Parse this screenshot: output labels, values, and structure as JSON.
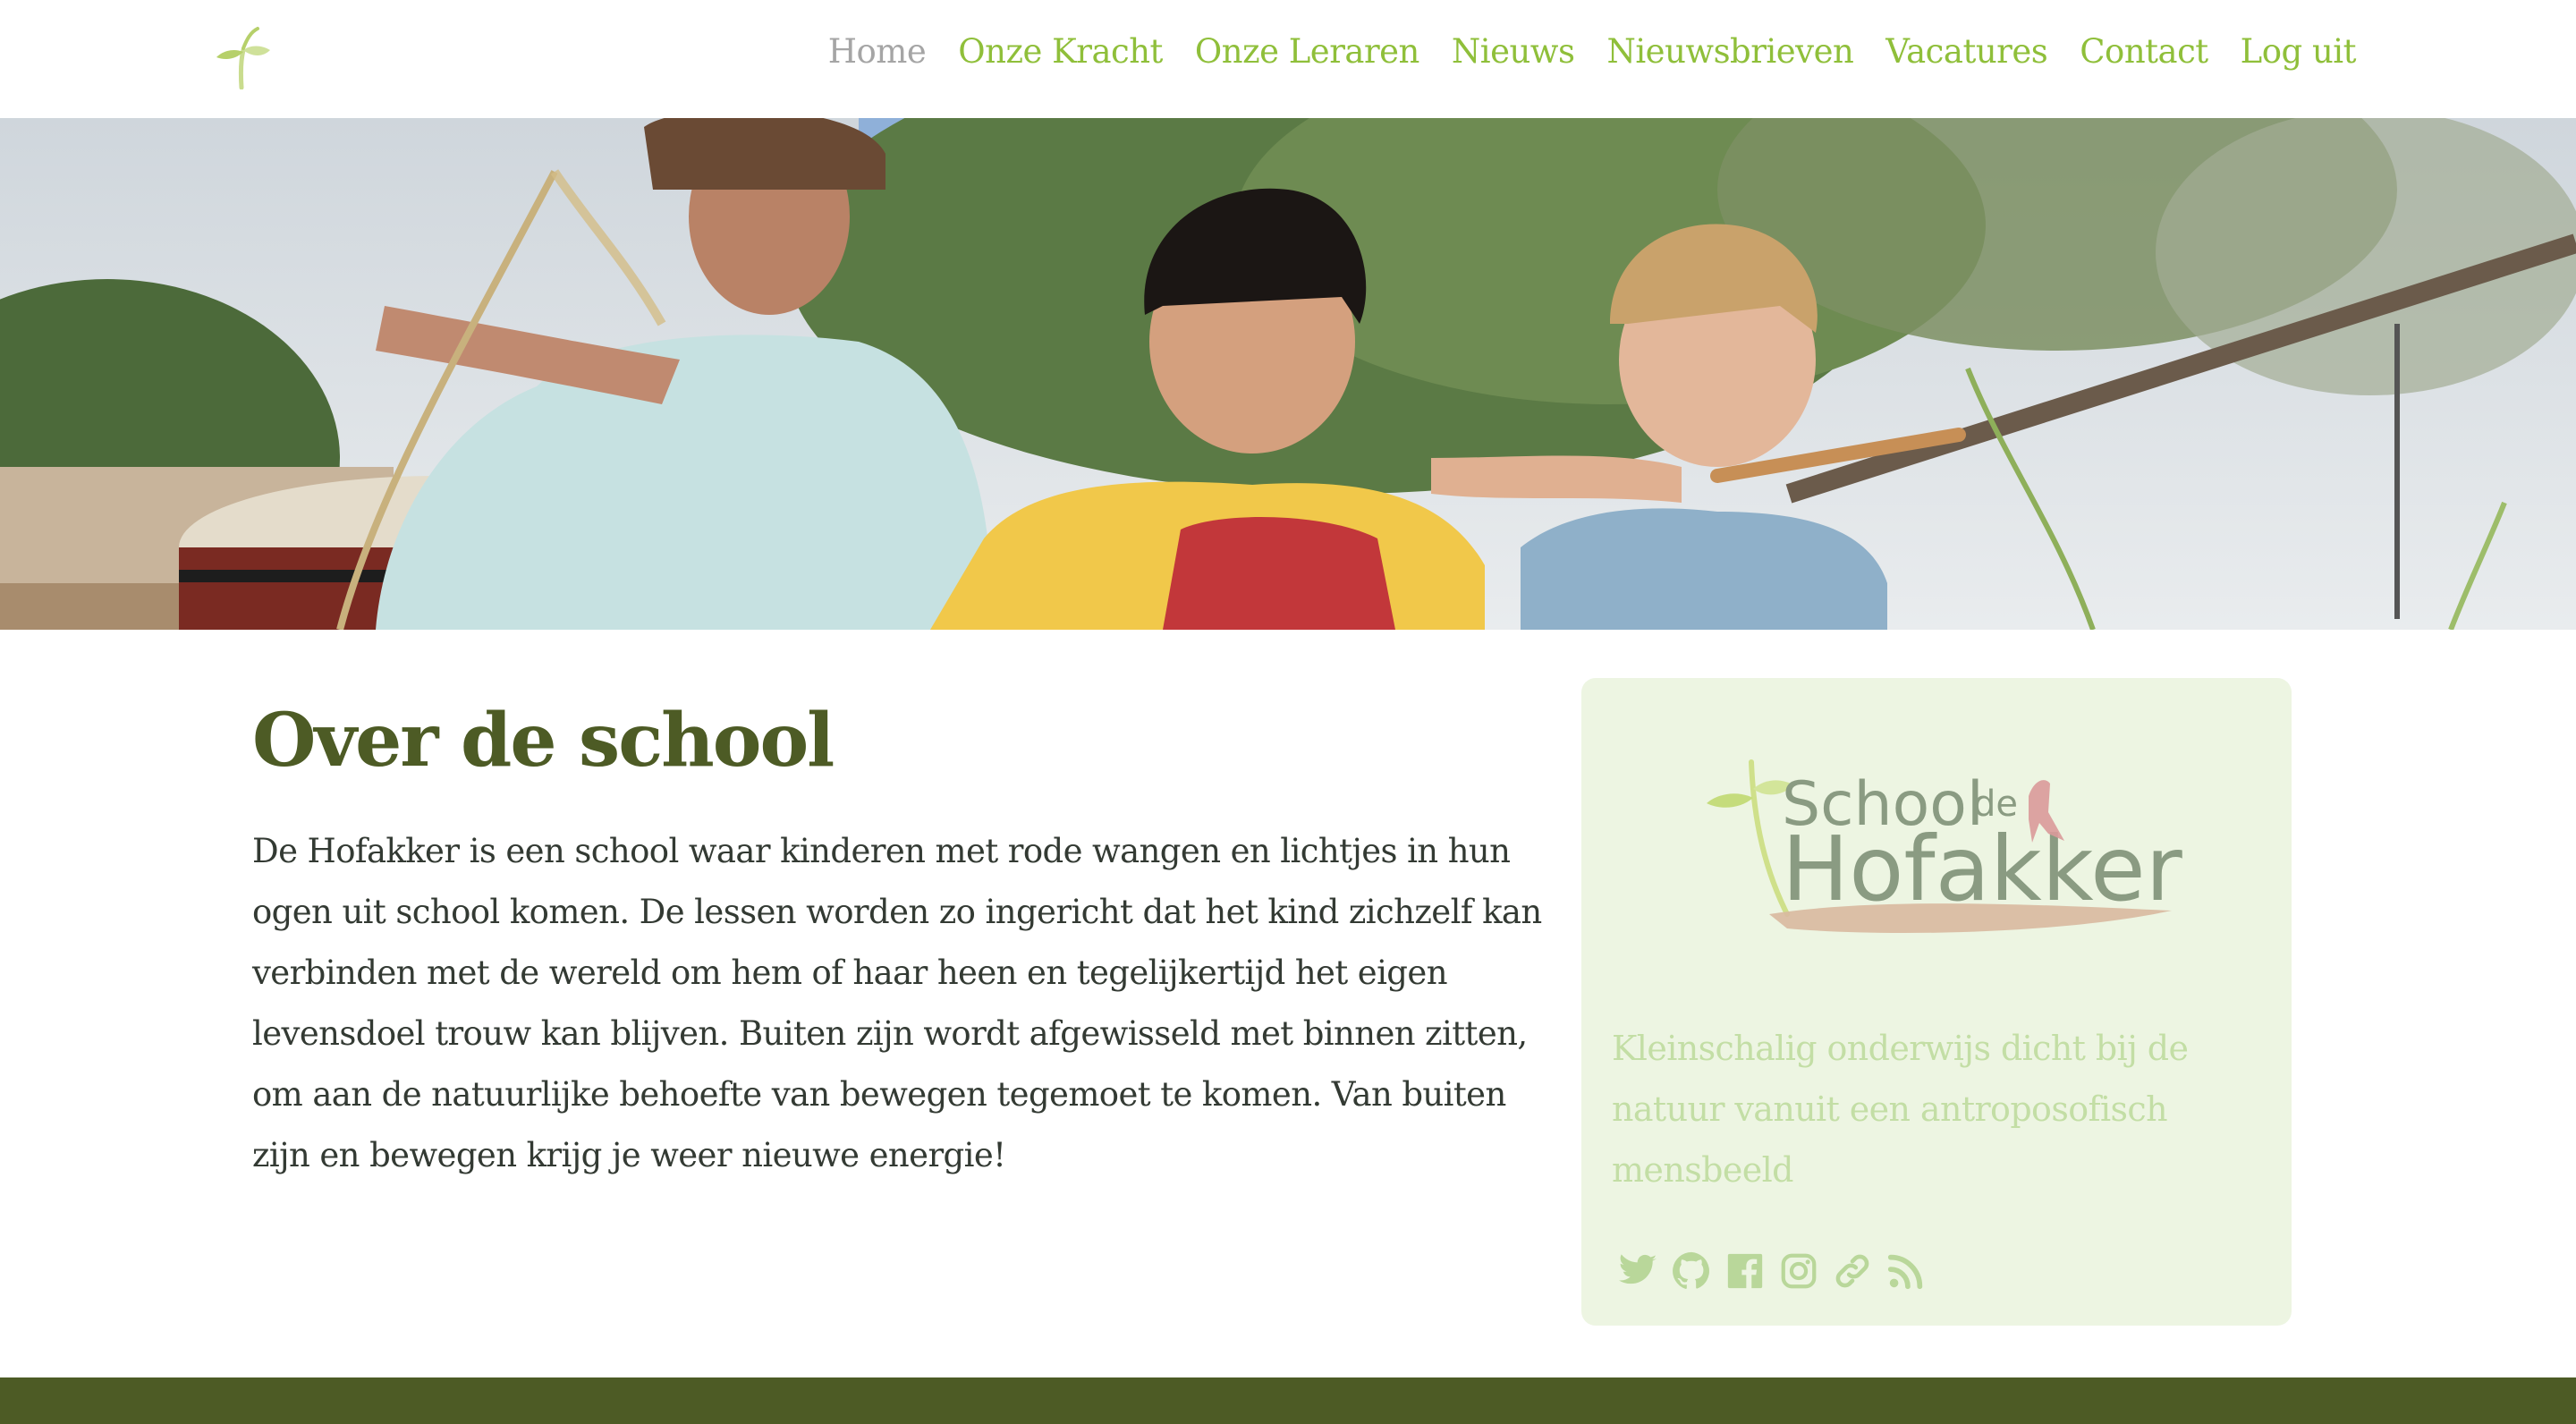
{
  "nav": {
    "items": [
      {
        "label": "Home",
        "active": true
      },
      {
        "label": "Onze Kracht",
        "active": false
      },
      {
        "label": "Onze Leraren",
        "active": false
      },
      {
        "label": "Nieuws",
        "active": false
      },
      {
        "label": "Nieuwsbrieven",
        "active": false
      },
      {
        "label": "Vacatures",
        "active": false
      },
      {
        "label": "Contact",
        "active": false
      },
      {
        "label": "Log uit",
        "active": false
      }
    ]
  },
  "main": {
    "title": "Over de school",
    "intro": "De Hofakker is een school waar kinderen met rode wangen en lichtjes in hun ogen uit school komen. De lessen worden zo ingericht dat het kind zichzelf kan verbinden met de wereld om hem of haar heen en tegelijkertijd het eigen levensdoel trouw kan blijven. Buiten zijn wordt afgewisseld met binnen zitten, om aan de natuurlijke behoefte van bewegen tegemoet te komen. Van buiten zijn en bewegen krijg je weer nieuwe energie!"
  },
  "sidebar": {
    "logo_text": {
      "school": "School",
      "de": "de",
      "name": "Hofakker"
    },
    "tagline": "Kleinschalig onderwijs dicht bij de natuur vanuit een antroposofisch mensbeeld",
    "socials": [
      "twitter-icon",
      "github-icon",
      "facebook-icon",
      "instagram-icon",
      "link-icon",
      "rss-icon"
    ]
  },
  "colors": {
    "accent": "#8fbf3a",
    "title": "#4d5b25",
    "footer": "#4d5b25",
    "sidebar_bg": "#edf5e2",
    "tagline": "#c3dea5",
    "icon": "#b9d79a"
  }
}
